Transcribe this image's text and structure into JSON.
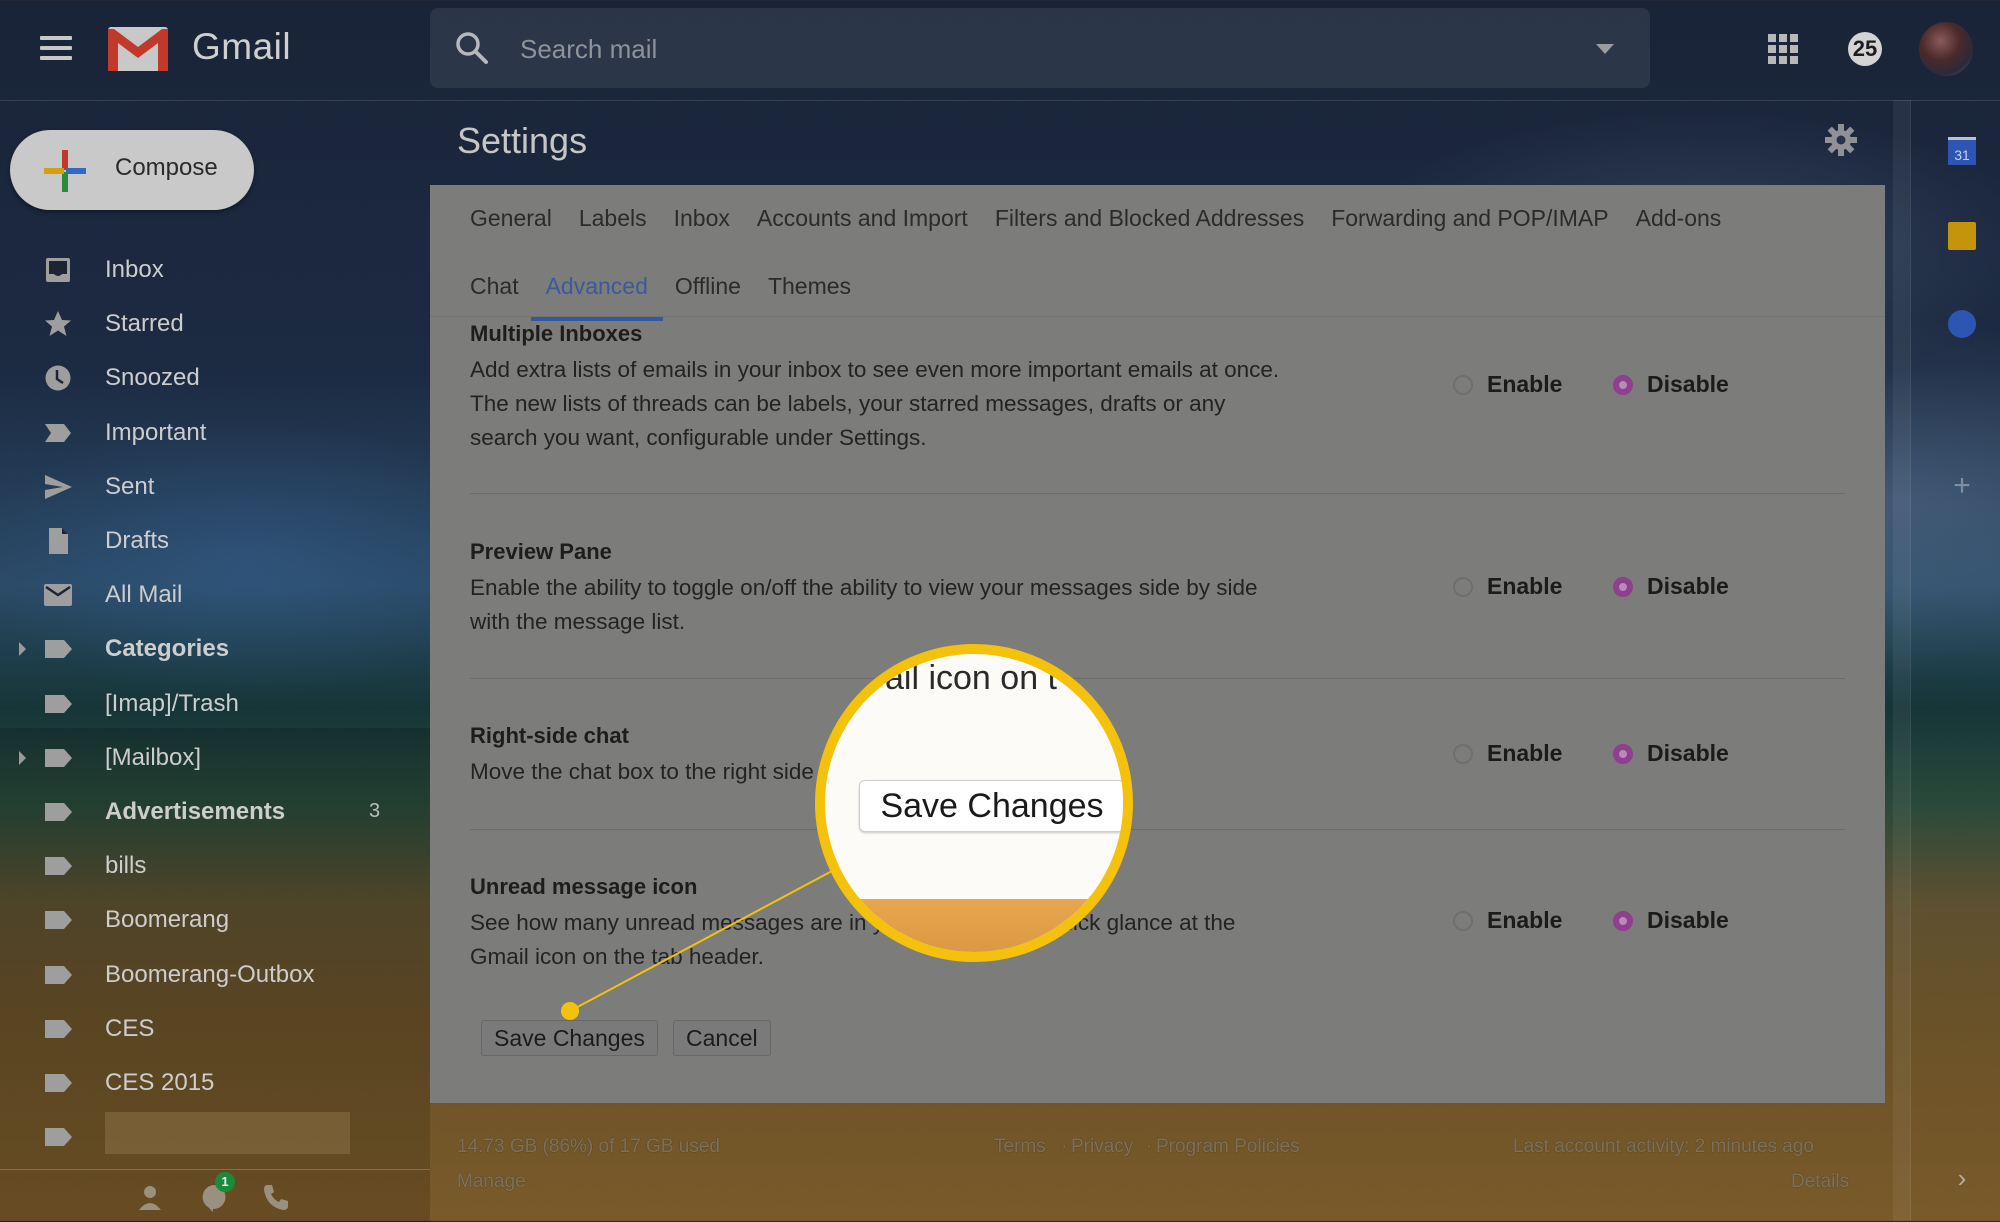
{
  "app": {
    "brand": "Gmail",
    "accent_color": "#EA4335",
    "active_tab_color": "#3a5a9c",
    "radio_selected_color": "#8e3f8e",
    "callout_color": "#f4c20d"
  },
  "header": {
    "search_placeholder": "Search mail",
    "notification_count": "25",
    "icons": [
      "hamburger-menu-icon",
      "gmail-logo-icon",
      "search-icon",
      "search-options-caret-icon",
      "apps-grid-icon",
      "notifications-badge",
      "account-avatar"
    ]
  },
  "compose": {
    "label": "Compose"
  },
  "sidebar": {
    "items": [
      {
        "label": "Inbox",
        "icon": "inbox-icon",
        "bold": false
      },
      {
        "label": "Starred",
        "icon": "star-icon",
        "bold": false
      },
      {
        "label": "Snoozed",
        "icon": "clock-icon",
        "bold": false
      },
      {
        "label": "Important",
        "icon": "important-icon",
        "bold": false
      },
      {
        "label": "Sent",
        "icon": "send-icon",
        "bold": false
      },
      {
        "label": "Drafts",
        "icon": "draft-icon",
        "bold": false
      },
      {
        "label": "All Mail",
        "icon": "mail-icon",
        "bold": false
      },
      {
        "label": "Categories",
        "icon": "label-icon",
        "bold": true,
        "expandable": true
      },
      {
        "label": "[Imap]/Trash",
        "icon": "label-icon",
        "bold": false
      },
      {
        "label": "[Mailbox]",
        "icon": "label-icon",
        "bold": false,
        "expandable": true
      },
      {
        "label": "Advertisements",
        "icon": "label-icon",
        "bold": true,
        "count": "3"
      },
      {
        "label": "bills",
        "icon": "label-icon",
        "bold": false
      },
      {
        "label": "Boomerang",
        "icon": "label-icon",
        "bold": false
      },
      {
        "label": "Boomerang-Outbox",
        "icon": "label-icon",
        "bold": false
      },
      {
        "label": "CES",
        "icon": "label-icon",
        "bold": false
      },
      {
        "label": "CES 2015",
        "icon": "label-icon",
        "bold": false
      },
      {
        "label": "",
        "icon": "label-icon",
        "bold": false
      }
    ],
    "hangouts_badge": "1"
  },
  "settings": {
    "title": "Settings",
    "tabs_row1": [
      "General",
      "Labels",
      "Inbox",
      "Accounts and Import",
      "Filters and Blocked Addresses",
      "Forwarding and POP/IMAP",
      "Add-ons"
    ],
    "tabs_row2": [
      "Chat",
      "Advanced",
      "Offline",
      "Themes"
    ],
    "active_tab": "Advanced",
    "sections": [
      {
        "title": "Multiple Inboxes",
        "description": "Add extra lists of emails in your inbox to see even more important emails at once. The new lists of threads can be labels, your starred messages, drafts or any search you want, configurable under Settings.",
        "enable_label": "Enable",
        "disable_label": "Disable",
        "selected": "Disable"
      },
      {
        "title": "Preview Pane",
        "description": "Enable the ability to toggle on/off the ability to view your messages side by side with the message list.",
        "enable_label": "Enable",
        "disable_label": "Disable",
        "selected": "Disable"
      },
      {
        "title": "Right-side chat",
        "description": "Move the chat box to the right side of the inbox.",
        "enable_label": "Enable",
        "disable_label": "Disable",
        "selected": "Disable"
      },
      {
        "title": "Unread message icon",
        "description": "See how many unread messages are in your inbox with a quick glance at the Gmail icon on the tab header.",
        "enable_label": "Enable",
        "disable_label": "Disable",
        "selected": "Disable"
      }
    ],
    "save_label": "Save Changes",
    "cancel_label": "Cancel"
  },
  "magnifier": {
    "ghost_text": "ail icon on t",
    "button_label": "Save Changes"
  },
  "footer": {
    "storage": "14.73 GB (86%) of 17 GB used",
    "storage_percent": 86,
    "manage": "Manage",
    "terms": "Terms",
    "privacy": "Privacy",
    "policies": "Program Policies",
    "separator": "·",
    "last_activity": "Last account activity: 2 minutes ago",
    "details": "Details"
  },
  "right_rail": {
    "calendar_day": "31",
    "add_label": "+",
    "expand_label": "›"
  }
}
